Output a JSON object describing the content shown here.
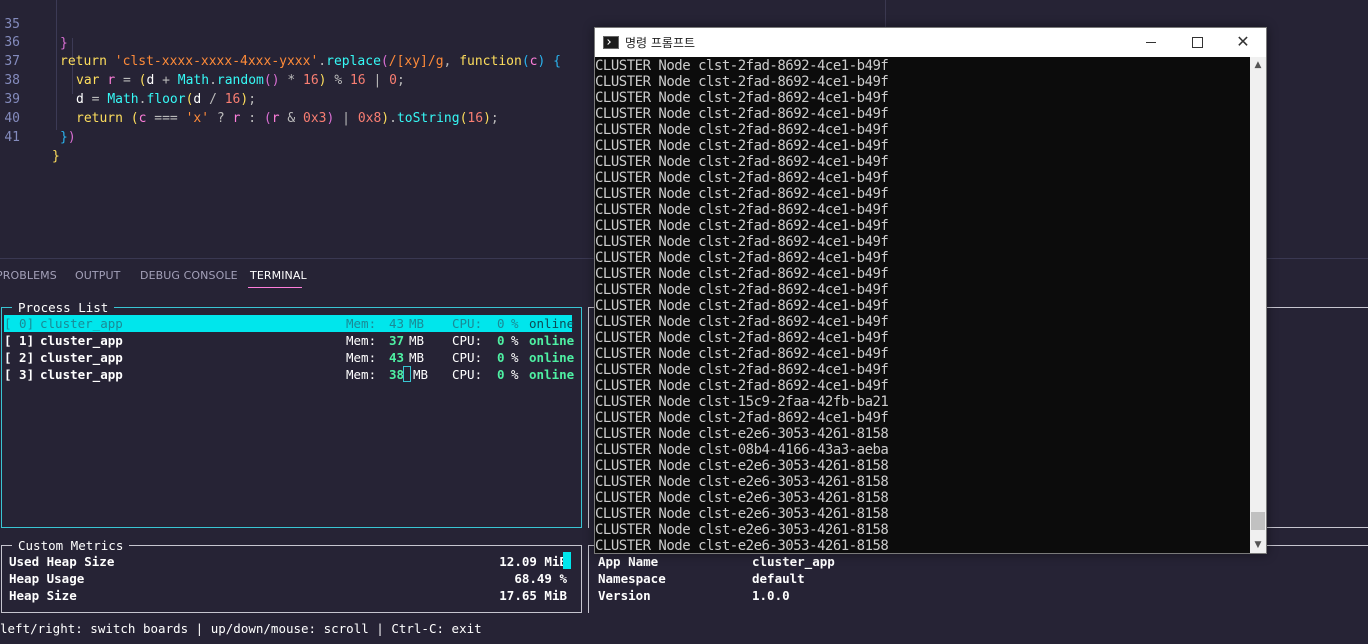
{
  "editor": {
    "lines": [
      {
        "no": "35"
      },
      {
        "no": "36"
      },
      {
        "no": "37"
      },
      {
        "no": "38"
      },
      {
        "no": "39"
      },
      {
        "no": "40"
      },
      {
        "no": "41"
      }
    ],
    "code": {
      "l36_return": "return",
      "l36_string": "'clst-xxxx-xxxx-4xxx-yxxx'",
      "l36_replace": "replace",
      "l36_regex": "/[xy]/g",
      "l36_function": "function",
      "l36_param": "c",
      "l37_var": "var",
      "l37_r": "r",
      "l37_d": "d",
      "l37_math": "Math",
      "l37_random": "random",
      "l37_16": "16",
      "l37_16b": "16",
      "l37_0": "0",
      "l38_d": "d",
      "l38_math": "Math",
      "l38_floor": "floor",
      "l38_d2": "d",
      "l38_16": "16",
      "l39_return": "return",
      "l39_c": "c",
      "l39_x": "'x'",
      "l39_r": "r",
      "l39_r2": "r",
      "l39_0x3": "0x3",
      "l39_0x8": "0x8",
      "l39_tostring": "toString",
      "l39_16": "16"
    }
  },
  "panel": {
    "tabs": [
      {
        "label": "PROBLEMS"
      },
      {
        "label": "OUTPUT"
      },
      {
        "label": "DEBUG CONSOLE"
      },
      {
        "label": "TERMINAL"
      }
    ],
    "active_tab": "TERMINAL"
  },
  "process_list": {
    "title": "Process List",
    "rows": [
      {
        "id": "[ 0]",
        "name": "cluster_app",
        "mem_label": "Mem:",
        "mem": "43",
        "mem_unit": "MB",
        "cpu_label": "CPU:",
        "cpu": "0",
        "cpu_unit": "%",
        "status": "online",
        "selected": true
      },
      {
        "id": "[ 1]",
        "name": "cluster_app",
        "mem_label": "Mem:",
        "mem": "37",
        "mem_unit": "MB",
        "cpu_label": "CPU:",
        "cpu": "0",
        "cpu_unit": "%",
        "status": "online"
      },
      {
        "id": "[ 2]",
        "name": "cluster_app",
        "mem_label": "Mem:",
        "mem": "43",
        "mem_unit": "MB",
        "cpu_label": "CPU:",
        "cpu": "0",
        "cpu_unit": "%",
        "status": "online"
      },
      {
        "id": "[ 3]",
        "name": "cluster_app",
        "mem_label": "Mem:",
        "mem": "38",
        "mem_unit": "MB",
        "cpu_label": "CPU:",
        "cpu": "0",
        "cpu_unit": "%",
        "status": "online"
      }
    ]
  },
  "metrics": {
    "title": "Custom Metrics",
    "rows": [
      {
        "label": "Used Heap Size",
        "value": "12.09 MiB"
      },
      {
        "label": "Heap Usage",
        "value": "68.49 %"
      },
      {
        "label": "Heap Size",
        "value": "17.65 MiB"
      }
    ]
  },
  "app_info": {
    "rows": [
      {
        "label": "App Name",
        "value": "cluster_app"
      },
      {
        "label": "Namespace",
        "value": "default"
      },
      {
        "label": "Version",
        "value": "1.0.0"
      }
    ]
  },
  "footer": {
    "hint": "left/right: switch boards | up/down/mouse: scroll | Ctrl-C: exit"
  },
  "cmd": {
    "title": "명령 프롬프트",
    "close_glyph": "✕",
    "scroll_up": "▲",
    "scroll_down": "▼",
    "lines": [
      "CLUSTER Node clst-2fad-8692-4ce1-b49f",
      "CLUSTER Node clst-2fad-8692-4ce1-b49f",
      "CLUSTER Node clst-2fad-8692-4ce1-b49f",
      "CLUSTER Node clst-2fad-8692-4ce1-b49f",
      "CLUSTER Node clst-2fad-8692-4ce1-b49f",
      "CLUSTER Node clst-2fad-8692-4ce1-b49f",
      "CLUSTER Node clst-2fad-8692-4ce1-b49f",
      "CLUSTER Node clst-2fad-8692-4ce1-b49f",
      "CLUSTER Node clst-2fad-8692-4ce1-b49f",
      "CLUSTER Node clst-2fad-8692-4ce1-b49f",
      "CLUSTER Node clst-2fad-8692-4ce1-b49f",
      "CLUSTER Node clst-2fad-8692-4ce1-b49f",
      "CLUSTER Node clst-2fad-8692-4ce1-b49f",
      "CLUSTER Node clst-2fad-8692-4ce1-b49f",
      "CLUSTER Node clst-2fad-8692-4ce1-b49f",
      "CLUSTER Node clst-2fad-8692-4ce1-b49f",
      "CLUSTER Node clst-2fad-8692-4ce1-b49f",
      "CLUSTER Node clst-2fad-8692-4ce1-b49f",
      "CLUSTER Node clst-2fad-8692-4ce1-b49f",
      "CLUSTER Node clst-2fad-8692-4ce1-b49f",
      "CLUSTER Node clst-2fad-8692-4ce1-b49f",
      "CLUSTER Node clst-15c9-2faa-42fb-ba21",
      "CLUSTER Node clst-2fad-8692-4ce1-b49f",
      "CLUSTER Node clst-e2e6-3053-4261-8158",
      "CLUSTER Node clst-08b4-4166-43a3-aeba",
      "CLUSTER Node clst-e2e6-3053-4261-8158",
      "CLUSTER Node clst-e2e6-3053-4261-8158",
      "CLUSTER Node clst-e2e6-3053-4261-8158",
      "CLUSTER Node clst-e2e6-3053-4261-8158",
      "CLUSTER Node clst-e2e6-3053-4261-8158",
      "CLUSTER Node clst-e2e6-3053-4261-8158",
      "CLUSTER Node clst-e2e6-3053-4261-8158"
    ]
  }
}
